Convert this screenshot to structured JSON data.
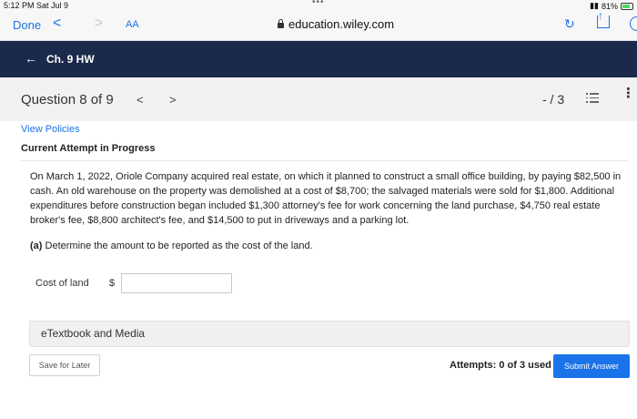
{
  "status_bar": {
    "time": "5:12 PM  Sat Jul 9",
    "battery": "81%",
    "center_dots": "•••"
  },
  "browser": {
    "done_label": "Done",
    "back_glyph": "<",
    "forward_glyph": ">",
    "text_size_label": "AA",
    "url": "education.wiley.com",
    "reload_glyph": "↻"
  },
  "header": {
    "back_glyph": "←",
    "title": "Ch. 9 HW"
  },
  "question_bar": {
    "title": "Question 8 of 9",
    "prev_glyph": "<",
    "next_glyph": ">",
    "score": "- / 3",
    "more_glyph": "⋮"
  },
  "content": {
    "view_policies": "View Policies",
    "attempt_label": "Current Attempt in Progress",
    "problem_text": "On March 1, 2022, Oriole Company acquired real estate, on which it planned to construct a small office building, by paying $82,500 in cash. An old warehouse on the property was demolished at a cost of $8,700; the salvaged materials were sold for $1,800. Additional expenditures before construction began included $1,300 attorney's fee for work concerning the land purchase, $4,750 real estate broker's fee, $8,800 architect's fee, and $14,500 to put in driveways and a parking lot.",
    "part_a_label": "(a)",
    "part_a_text": "Determine the amount to be reported as the cost of the land.",
    "cost_label": "Cost of land",
    "currency_symbol": "$",
    "cost_value": "",
    "etextbook_label": "eTextbook and Media",
    "save_label": "Save for Later",
    "attempts_text": "Attempts: 0 of 3 used",
    "submit_label": "Submit Answer"
  },
  "colors": {
    "header_bg": "#1b2a4a",
    "accent": "#1a73e8"
  }
}
